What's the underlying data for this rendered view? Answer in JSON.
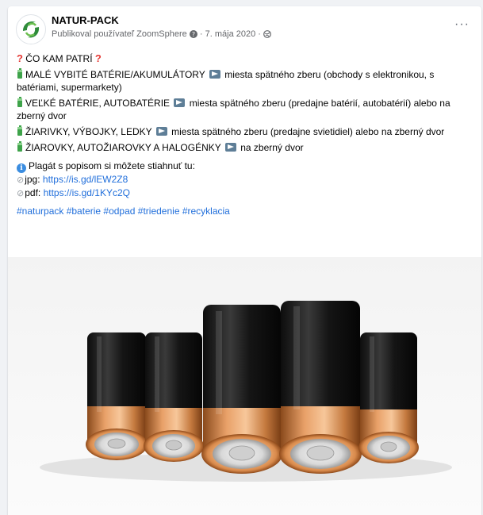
{
  "post": {
    "page_name": "NATUR-PACK",
    "meta_text": "Publikoval používateľ ZoomSphere",
    "date": "7. mája 2020",
    "more": "···"
  },
  "content": {
    "title": "ČO KAM PATRÍ",
    "items": [
      {
        "label": "MALÉ VYBITÉ BATÉRIE/AKUMULÁTORY",
        "target": "miesta spätného zberu (obchody s elektronikou, s batériami, supermarkety)"
      },
      {
        "label": "VEĽKÉ BATÉRIE, AUTOBATÉRIE",
        "target": "miesta spätného zberu (predajne batérií, autobatérií) alebo na zberný dvor"
      },
      {
        "label": "ŽIARIVKY, VÝBOJKY, LEDKY",
        "target": "miesta spätného zberu (predajne svietidiel) alebo na zberný dvor"
      },
      {
        "label": "ŽIAROVKY, AUTOŽIAROVKY A HALOGÉNKY",
        "target": "na zberný dvor"
      }
    ],
    "download_text": "Plagát s popisom si môžete stiahnuť tu:",
    "jpg_label": "jpg:",
    "jpg_url": "https://is.gd/lEW2Z8",
    "pdf_label": "pdf:",
    "pdf_url": "https://is.gd/1KYc2Q",
    "hashtags": "#naturpack #baterie #odpad #triedenie #recyklacia"
  },
  "icons": {
    "question": "red-question-mark-icon",
    "battery": "battery-icon",
    "arrow": "right-arrow-icon",
    "info": "info-icon",
    "clip": "paperclip-icon",
    "globe": "globe-icon",
    "help": "question-circle-icon"
  },
  "colors": {
    "link": "#216fdb",
    "meta": "#65676b",
    "battery_green": "#3ea34a"
  }
}
